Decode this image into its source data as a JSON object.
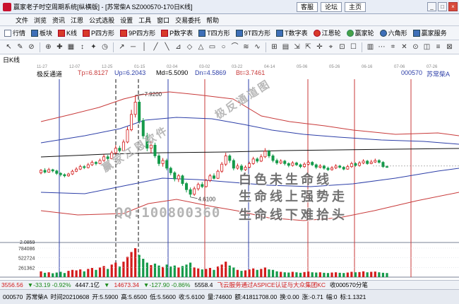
{
  "window": {
    "title": "赢家老子时空周期系统[纵横版] - [苏常柴A  SZ000570-170日K线]",
    "links": [
      "客服",
      "论坛",
      "主页"
    ],
    "controls": [
      "_",
      "□",
      "×"
    ]
  },
  "menu": [
    "文件",
    "浏览",
    "资讯",
    "江恩",
    "公式选股",
    "设置",
    "工具",
    "窗口",
    "交易委托",
    "帮助"
  ],
  "toolbar": [
    {
      "label": "行情",
      "icon": "grid-icon"
    },
    {
      "label": "板块",
      "icon": "blocks-icon"
    },
    {
      "label": "K线",
      "icon": "candle-icon"
    },
    {
      "label": "P四方形",
      "icon": "square-p-icon"
    },
    {
      "label": "9P四方形",
      "icon": "square-9p-icon"
    },
    {
      "label": "P数字表",
      "icon": "table-p-icon"
    },
    {
      "label": "T四方形",
      "icon": "square-t-icon"
    },
    {
      "label": "9T四方形",
      "icon": "square-9t-icon"
    },
    {
      "label": "T数字表",
      "icon": "table-t-icon"
    },
    {
      "label": "江恩轮",
      "icon": "wheel-icon"
    },
    {
      "label": "赢家轮",
      "icon": "winner-wheel-icon"
    },
    {
      "label": "六角形",
      "icon": "hexagon-icon"
    },
    {
      "label": "赢家服务",
      "icon": "service-icon"
    }
  ],
  "draw_tools": [
    "↖",
    "✎",
    "⊘",
    "⊕",
    "✚",
    "▦",
    "↕",
    "✦",
    "◷",
    "↗",
    "─",
    "│",
    "╱",
    "╲",
    "⊿",
    "◇",
    "△",
    "▭",
    "○",
    "⌒",
    "≋",
    "∿",
    "⊞",
    "▤",
    "⇲",
    "⇱",
    "✛",
    "⌖",
    "⊡",
    "☐",
    "▥",
    "⋯",
    "⌗",
    "✕",
    "⊙",
    "◫",
    "≡",
    "⊠"
  ],
  "chart": {
    "tab": "日K线",
    "dates": [
      "11-27",
      "12-07",
      "12-25",
      "01-15",
      "02-04",
      "03-02",
      "03-22",
      "04-14",
      "05-06",
      "05-26",
      "06-16",
      "07-06",
      "07-26"
    ],
    "header": {
      "reversal_label": "极反通道",
      "tp": "Tp=6.8127",
      "up": "Up=6.2043",
      "md": "Md=5.5090",
      "dn": "Dn=4.5869",
      "bt": "Bt=3.7461",
      "code": "000570",
      "name": "苏常柴A"
    },
    "price_labels": {
      "high": "7.9200",
      "low": "4.6100"
    },
    "volume_labels": [
      "2.0859",
      "784086",
      "522724",
      "261362"
    ]
  },
  "chart_data": {
    "type": "candlestick",
    "title": "苏常柴A SZ000570 日K线",
    "highest_marked": 7.92,
    "lowest_marked": 4.61,
    "channel": {
      "tp": 6.8127,
      "up": 6.2043,
      "md": 5.509,
      "dn": 4.5869,
      "bt": 3.7461
    },
    "volume_ticks": [
      784086,
      522724,
      261362
    ],
    "candles": [
      {
        "o": 5.4,
        "c": 5.48,
        "h": 5.52,
        "l": 5.35
      },
      {
        "o": 5.48,
        "c": 5.42,
        "h": 5.55,
        "l": 5.38
      },
      {
        "o": 5.42,
        "c": 5.5,
        "h": 5.56,
        "l": 5.4
      },
      {
        "o": 5.5,
        "c": 5.46,
        "h": 5.53,
        "l": 5.41
      },
      {
        "o": 5.46,
        "c": 5.38,
        "h": 5.5,
        "l": 5.33
      },
      {
        "o": 5.38,
        "c": 5.34,
        "h": 5.42,
        "l": 5.28
      },
      {
        "o": 5.34,
        "c": 5.3,
        "h": 5.38,
        "l": 5.25
      },
      {
        "o": 5.3,
        "c": 5.36,
        "h": 5.4,
        "l": 5.27
      },
      {
        "o": 5.36,
        "c": 5.45,
        "h": 5.5,
        "l": 5.33
      },
      {
        "o": 5.45,
        "c": 5.52,
        "h": 5.58,
        "l": 5.42
      },
      {
        "o": 5.52,
        "c": 5.6,
        "h": 5.66,
        "l": 5.49
      },
      {
        "o": 5.6,
        "c": 5.57,
        "h": 5.65,
        "l": 5.52
      },
      {
        "o": 5.57,
        "c": 5.66,
        "h": 5.72,
        "l": 5.54
      },
      {
        "o": 5.66,
        "c": 5.74,
        "h": 5.8,
        "l": 5.62
      },
      {
        "o": 5.74,
        "c": 5.7,
        "h": 5.78,
        "l": 5.64
      },
      {
        "o": 5.7,
        "c": 5.8,
        "h": 5.86,
        "l": 5.68
      },
      {
        "o": 5.8,
        "c": 5.92,
        "h": 6.0,
        "l": 5.76
      },
      {
        "o": 5.92,
        "c": 5.86,
        "h": 5.98,
        "l": 5.8
      },
      {
        "o": 5.86,
        "c": 6.05,
        "h": 6.12,
        "l": 5.84
      },
      {
        "o": 6.05,
        "c": 6.2,
        "h": 6.3,
        "l": 6.0
      },
      {
        "o": 6.2,
        "c": 6.12,
        "h": 6.28,
        "l": 6.06
      },
      {
        "o": 6.12,
        "c": 6.4,
        "h": 6.48,
        "l": 6.1
      },
      {
        "o": 6.4,
        "c": 6.8,
        "h": 6.9,
        "l": 6.36
      },
      {
        "o": 6.8,
        "c": 7.3,
        "h": 7.45,
        "l": 6.75
      },
      {
        "o": 7.3,
        "c": 7.7,
        "h": 7.92,
        "l": 7.2
      },
      {
        "o": 7.7,
        "c": 7.1,
        "h": 7.78,
        "l": 7.0
      },
      {
        "o": 7.1,
        "c": 6.6,
        "h": 7.18,
        "l": 6.5
      },
      {
        "o": 6.6,
        "c": 6.2,
        "h": 6.7,
        "l": 6.1
      },
      {
        "o": 6.2,
        "c": 6.3,
        "h": 6.45,
        "l": 6.05
      },
      {
        "o": 6.3,
        "c": 5.95,
        "h": 6.38,
        "l": 5.88
      },
      {
        "o": 5.95,
        "c": 5.7,
        "h": 6.02,
        "l": 5.62
      },
      {
        "o": 5.7,
        "c": 5.8,
        "h": 5.88,
        "l": 5.6
      },
      {
        "o": 5.8,
        "c": 5.55,
        "h": 5.86,
        "l": 5.48
      },
      {
        "o": 5.55,
        "c": 5.4,
        "h": 5.6,
        "l": 5.32
      },
      {
        "o": 5.4,
        "c": 5.2,
        "h": 5.45,
        "l": 5.12
      },
      {
        "o": 5.2,
        "c": 5.3,
        "h": 5.36,
        "l": 5.1
      },
      {
        "o": 5.3,
        "c": 5.05,
        "h": 5.34,
        "l": 4.98
      },
      {
        "o": 5.05,
        "c": 4.85,
        "h": 5.1,
        "l": 4.76
      },
      {
        "o": 4.85,
        "c": 4.7,
        "h": 4.92,
        "l": 4.61
      },
      {
        "o": 4.7,
        "c": 4.88,
        "h": 4.95,
        "l": 4.65
      },
      {
        "o": 4.88,
        "c": 5.02,
        "h": 5.08,
        "l": 4.82
      },
      {
        "o": 5.02,
        "c": 4.95,
        "h": 5.1,
        "l": 4.9
      },
      {
        "o": 4.95,
        "c": 5.15,
        "h": 5.2,
        "l": 4.92
      },
      {
        "o": 5.15,
        "c": 5.3,
        "h": 5.36,
        "l": 5.1
      },
      {
        "o": 5.3,
        "c": 5.22,
        "h": 5.38,
        "l": 5.18
      },
      {
        "o": 5.22,
        "c": 5.45,
        "h": 5.5,
        "l": 5.2
      },
      {
        "o": 5.45,
        "c": 5.68,
        "h": 5.75,
        "l": 5.4
      },
      {
        "o": 5.68,
        "c": 5.95,
        "h": 6.05,
        "l": 5.62
      },
      {
        "o": 5.95,
        "c": 5.8,
        "h": 6.0,
        "l": 5.72
      },
      {
        "o": 5.8,
        "c": 5.55,
        "h": 5.86,
        "l": 5.48
      },
      {
        "o": 5.55,
        "c": 5.62,
        "h": 5.7,
        "l": 5.5
      },
      {
        "o": 5.62,
        "c": 5.5,
        "h": 5.68,
        "l": 5.44
      },
      {
        "o": 5.5,
        "c": 5.58,
        "h": 5.64,
        "l": 5.46
      },
      {
        "o": 5.58,
        "c": 5.7,
        "h": 5.76,
        "l": 5.55
      },
      {
        "o": 5.7,
        "c": 5.85,
        "h": 5.92,
        "l": 5.66
      },
      {
        "o": 5.85,
        "c": 5.78,
        "h": 5.9,
        "l": 5.72
      },
      {
        "o": 5.78,
        "c": 5.92,
        "h": 6.0,
        "l": 5.75
      },
      {
        "o": 5.92,
        "c": 6.1,
        "h": 6.2,
        "l": 5.88
      },
      {
        "o": 6.1,
        "c": 5.95,
        "h": 6.15,
        "l": 5.88
      },
      {
        "o": 5.95,
        "c": 5.8,
        "h": 6.0,
        "l": 5.74
      },
      {
        "o": 5.8,
        "c": 5.72,
        "h": 5.86,
        "l": 5.66
      },
      {
        "o": 5.72,
        "c": 5.78,
        "h": 5.84,
        "l": 5.68
      },
      {
        "o": 5.78,
        "c": 5.7,
        "h": 5.82,
        "l": 5.64
      },
      {
        "o": 5.7,
        "c": 5.64,
        "h": 5.74,
        "l": 5.58
      },
      {
        "o": 5.64,
        "c": 5.72,
        "h": 5.78,
        "l": 5.6
      },
      {
        "o": 5.72,
        "c": 5.66,
        "h": 5.76,
        "l": 5.62
      },
      {
        "o": 5.66,
        "c": 5.6,
        "h": 5.7,
        "l": 5.55
      },
      {
        "o": 5.6,
        "c": 5.68,
        "h": 5.74,
        "l": 5.56
      },
      {
        "o": 5.68,
        "c": 5.74,
        "h": 5.8,
        "l": 5.64
      },
      {
        "o": 5.74,
        "c": 5.66,
        "h": 5.78,
        "l": 5.62
      },
      {
        "o": 5.66,
        "c": 5.58,
        "h": 5.7,
        "l": 5.52
      },
      {
        "o": 5.58,
        "c": 5.62,
        "h": 5.68,
        "l": 5.54
      },
      {
        "o": 5.62,
        "c": 5.55,
        "h": 5.66,
        "l": 5.5
      },
      {
        "o": 5.55,
        "c": 5.5,
        "h": 5.6,
        "l": 5.46
      },
      {
        "o": 5.5,
        "c": 5.56,
        "h": 5.62,
        "l": 5.47
      },
      {
        "o": 5.56,
        "c": 5.62,
        "h": 5.68,
        "l": 5.52
      },
      {
        "o": 5.62,
        "c": 5.58,
        "h": 5.66,
        "l": 5.54
      },
      {
        "o": 5.58,
        "c": 5.52,
        "h": 5.62,
        "l": 5.48
      },
      {
        "o": 5.52,
        "c": 5.6,
        "h": 5.66,
        "l": 5.5
      },
      {
        "o": 5.6,
        "c": 5.7,
        "h": 5.76,
        "l": 5.56
      },
      {
        "o": 5.7,
        "c": 5.64,
        "h": 5.74,
        "l": 5.6
      },
      {
        "o": 5.64,
        "c": 5.72,
        "h": 5.78,
        "l": 5.6
      },
      {
        "o": 5.72,
        "c": 5.78,
        "h": 5.84,
        "l": 5.68
      },
      {
        "o": 5.78,
        "c": 5.7,
        "h": 5.82,
        "l": 5.66
      },
      {
        "o": 5.7,
        "c": 5.75,
        "h": 5.82,
        "l": 5.68
      },
      {
        "o": 5.75,
        "c": 5.8,
        "h": 5.86,
        "l": 5.72
      },
      {
        "o": 5.8,
        "c": 5.74,
        "h": 5.84,
        "l": 5.7
      },
      {
        "o": 5.74,
        "c": 5.6,
        "h": 5.78,
        "l": 5.56
      },
      {
        "o": 5.6,
        "c": 5.58,
        "h": 5.64,
        "l": 5.56
      }
    ]
  },
  "annotations": [
    "白色未生命线",
    "生命线上强势走",
    "生命线下难拾头"
  ],
  "watermarks": {
    "qq": "QQ:100800360",
    "diag1": "赢家江恩软件",
    "diag2": "极反通道图"
  },
  "status_index": [
    {
      "text": "3556.56",
      "color": "#d31c1c"
    },
    {
      "text": "▼-33.19 -0.92%",
      "color": "#1b8a1b"
    },
    {
      "text": "4447.1亿",
      "color": "#000000"
    },
    {
      "text": "▼",
      "color": "#1b8a1b"
    },
    {
      "text": "14673.34",
      "color": "#d31c1c"
    },
    {
      "text": "▼-127.90 -0.86%",
      "color": "#1b8a1b"
    },
    {
      "text": "5558.4",
      "color": "#000000"
    }
  ],
  "status_news": "飞云服务通过ASPICE认证与大众集团KC",
  "status_receive": "收000570分笔",
  "stock_status": {
    "code": "000570",
    "name": "苏常柴A",
    "time": "时间20210608",
    "open": "开:5.5900",
    "high": "高:5.6500",
    "low": "低:5.5600",
    "close": "收:5.6100",
    "amount": "量:74600",
    "turnover": "额:41811708.00",
    "swing": "换:0.00",
    "change": "涨:-0.71",
    "ratio": "幅:0",
    "std": "标:1.1321"
  }
}
